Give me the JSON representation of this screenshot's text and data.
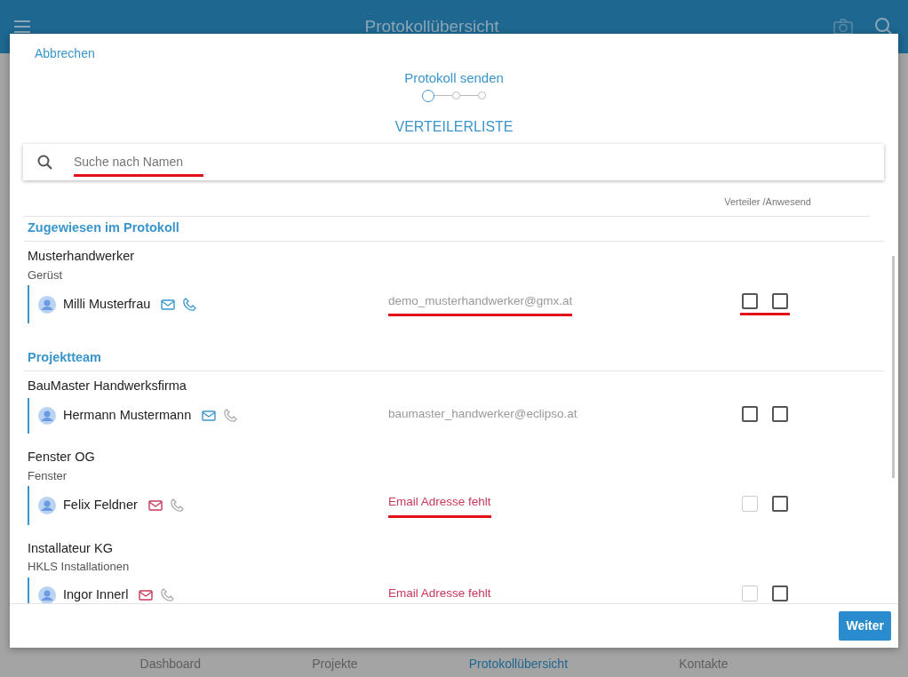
{
  "app_bar": {
    "title": "Protokollübersicht"
  },
  "bottom_nav": [
    {
      "label": "Dashboard",
      "selected": false
    },
    {
      "label": "Projekte",
      "selected": false
    },
    {
      "label": "Protokollübersicht",
      "selected": true
    },
    {
      "label": "Kontakte",
      "selected": false
    }
  ],
  "dialog": {
    "cancel": "Abbrechen",
    "step_title": "Protokoll senden",
    "steps": [
      {
        "selected": true
      },
      {
        "selected": false
      },
      {
        "selected": false
      }
    ],
    "heading": "VERTEILERLISTE",
    "search": {
      "placeholder": "Suche nach Namen",
      "underlined": true
    },
    "column_header": "Verteiler /Anwesend",
    "sections": [
      {
        "title": "Zugewiesen im Protokoll",
        "companies": [
          {
            "name": "Musterhandwerker",
            "trade": "Gerüst",
            "contacts": [
              {
                "name": "Milli Musterfrau",
                "email": "demo_musterhandwerker@gmx.at",
                "email_missing": false,
                "phone_available": true,
                "email_underlined": true,
                "checks_underlined": true,
                "checks": [
                  {
                    "checked": false,
                    "disabled": false
                  },
                  {
                    "checked": false,
                    "disabled": false
                  }
                ]
              }
            ]
          }
        ]
      },
      {
        "title": "Projektteam",
        "companies": [
          {
            "name": "BauMaster Handwerksfirma",
            "contacts": [
              {
                "name": "Hermann Mustermann",
                "email": "baumaster_handwerker@eclipso.at",
                "email_missing": false,
                "phone_available": false,
                "email_underlined": false,
                "checks_underlined": false,
                "checks": [
                  {
                    "checked": false,
                    "disabled": false
                  },
                  {
                    "checked": false,
                    "disabled": false
                  }
                ]
              }
            ]
          },
          {
            "name": "Fenster OG",
            "trade": "Fenster",
            "contacts": [
              {
                "name": "Felix Feldner",
                "email": "Email Adresse fehlt",
                "email_missing": true,
                "phone_available": false,
                "email_underlined": true,
                "checks_underlined": false,
                "checks": [
                  {
                    "checked": false,
                    "disabled": true
                  },
                  {
                    "checked": false,
                    "disabled": false
                  }
                ]
              }
            ]
          },
          {
            "name": "Installateur KG",
            "trade": "HKLS Installationen",
            "contacts": [
              {
                "name": "Ingor Innerl",
                "email": "Email Adresse fehlt",
                "email_missing": true,
                "phone_available": false,
                "email_underlined": false,
                "checks_underlined": false,
                "checks": [
                  {
                    "checked": false,
                    "disabled": true
                  },
                  {
                    "checked": false,
                    "disabled": false
                  }
                ]
              }
            ]
          }
        ]
      }
    ],
    "next_button": "Weiter"
  }
}
